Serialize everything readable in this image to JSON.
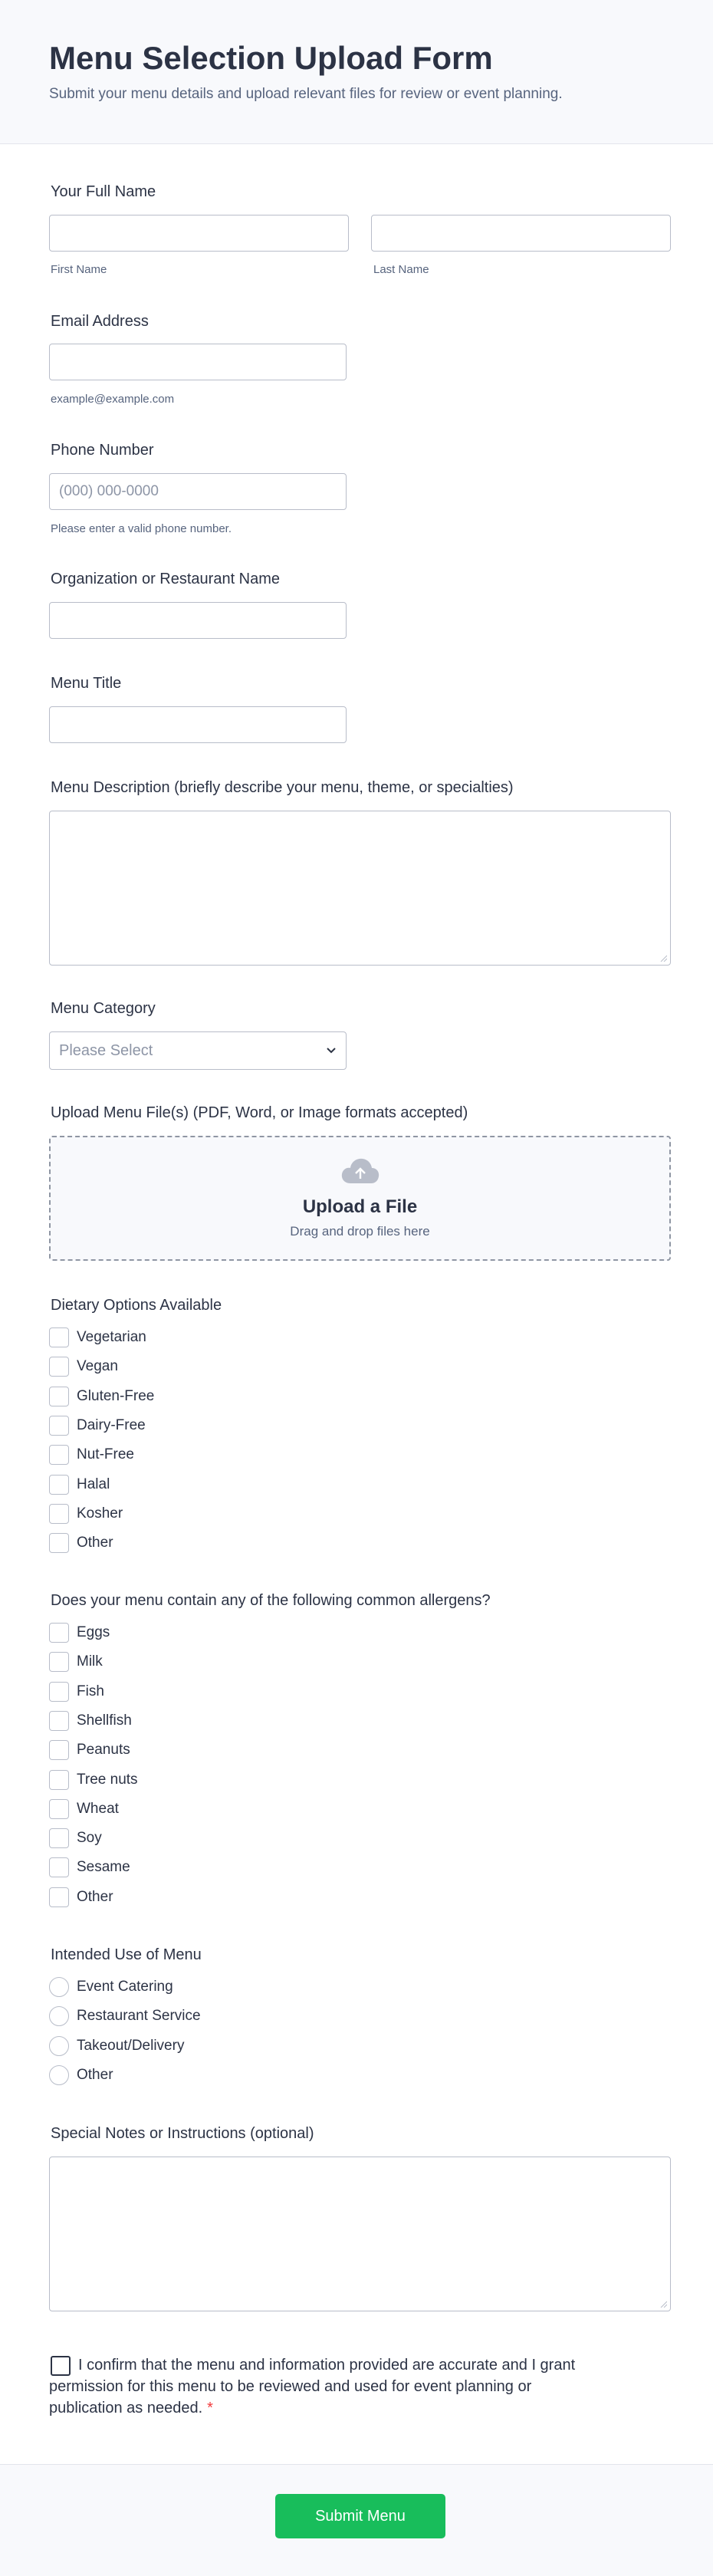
{
  "header": {
    "title": "Menu Selection Upload Form",
    "subtitle": "Submit your menu details and upload relevant files for review or event planning."
  },
  "full_name": {
    "label": "Your Full Name",
    "first_sublabel": "First Name",
    "last_sublabel": "Last Name"
  },
  "email": {
    "label": "Email Address",
    "sublabel": "example@example.com"
  },
  "phone": {
    "label": "Phone Number",
    "placeholder": "(000) 000-0000",
    "sublabel": "Please enter a valid phone number."
  },
  "organization": {
    "label": "Organization or Restaurant Name"
  },
  "menu_title": {
    "label": "Menu Title"
  },
  "menu_description": {
    "label": "Menu Description (briefly describe your menu, theme, or specialties)"
  },
  "menu_category": {
    "label": "Menu Category",
    "selected": "Please Select"
  },
  "upload": {
    "label": "Upload Menu File(s) (PDF, Word, or Image formats accepted)",
    "title": "Upload a File",
    "subtitle": "Drag and drop files here"
  },
  "dietary": {
    "label": "Dietary Options Available",
    "options": [
      "Vegetarian",
      "Vegan",
      "Gluten-Free",
      "Dairy-Free",
      "Nut-Free",
      "Halal",
      "Kosher",
      "Other"
    ]
  },
  "allergens": {
    "label": "Does your menu contain any of the following common allergens?",
    "options": [
      "Eggs",
      "Milk",
      "Fish",
      "Shellfish",
      "Peanuts",
      "Tree nuts",
      "Wheat",
      "Soy",
      "Sesame",
      "Other"
    ]
  },
  "intended_use": {
    "label": "Intended Use of Menu",
    "options": [
      "Event Catering",
      "Restaurant Service",
      "Takeout/Delivery",
      "Other"
    ]
  },
  "notes": {
    "label": "Special Notes or Instructions (optional)"
  },
  "confirm": {
    "text": "I confirm that the menu and information provided are accurate and I grant permission for this menu to be reviewed and used for event planning or publication as needed.",
    "required_mark": "*"
  },
  "submit": {
    "label": "Submit Menu"
  },
  "colors": {
    "submit": "#18bd5b",
    "required": "#f23a3c",
    "text": "#2c3345",
    "muted": "#57647e"
  }
}
